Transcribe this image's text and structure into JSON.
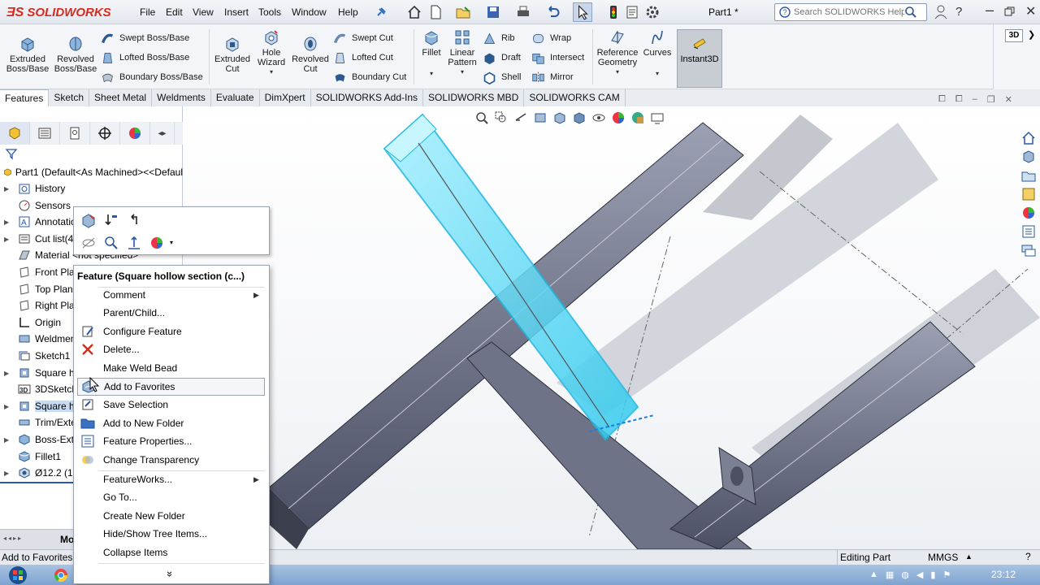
{
  "app": {
    "name": "SOLIDWORKS",
    "doc_title": "Part1 *"
  },
  "menu": [
    "File",
    "Edit",
    "View",
    "Insert",
    "Tools",
    "Window",
    "Help"
  ],
  "search": {
    "placeholder": "Search SOLIDWORKS Help"
  },
  "ribbon": {
    "big": [
      {
        "label1": "Extruded",
        "label2": "Boss/Base"
      },
      {
        "label1": "Revolved",
        "label2": "Boss/Base"
      },
      {
        "label1": "Extruded",
        "label2": "Cut"
      },
      {
        "label1": "Hole",
        "label2": "Wizard"
      },
      {
        "label1": "Revolved",
        "label2": "Cut"
      },
      {
        "label1": "Fillet",
        "label2": ""
      },
      {
        "label1": "Linear",
        "label2": "Pattern"
      },
      {
        "label1": "Reference",
        "label2": "Geometry"
      },
      {
        "label1": "Curves",
        "label2": ""
      }
    ],
    "small": [
      "Swept Boss/Base",
      "Lofted Boss/Base",
      "Boundary Boss/Base",
      "Swept Cut",
      "Lofted Cut",
      "Boundary Cut",
      "Rib",
      "Draft",
      "Shell",
      "Wrap",
      "Intersect",
      "Mirror"
    ],
    "instant3d": "Instant3D",
    "view_label": "3D"
  },
  "tabs": [
    "Features",
    "Sketch",
    "Sheet Metal",
    "Weldments",
    "Evaluate",
    "DimXpert",
    "SOLIDWORKS Add-Ins",
    "SOLIDWORKS MBD",
    "SOLIDWORKS CAM"
  ],
  "tree": {
    "root": "Part1  (Default<As Machined><<Defaul",
    "items": [
      "History",
      "Sensors",
      "Annotatio",
      "Cut list(4",
      "Material <not specified>",
      "Front Pla",
      "Top Plan",
      "Right Pla",
      "Origin",
      "Weldmen",
      "Sketch1",
      "Square ho",
      "3DSketch",
      "Square ho",
      "Trim/Exte",
      "Boss-Extr",
      "Fillet1",
      "Ø12.2 (12"
    ]
  },
  "context_menu": {
    "title": "Feature (Square hollow section (c...)",
    "items": [
      "Comment",
      "Parent/Child...",
      "Configure Feature",
      "Delete...",
      "Make Weld Bead",
      "Add to Favorites",
      "Save Selection",
      "Add to New Folder",
      "Feature Properties...",
      "Change Transparency",
      "FeatureWorks...",
      "Go To...",
      "Create New Folder",
      "Hide/Show Tree Items...",
      "Collapse Items"
    ],
    "more": "»"
  },
  "status": {
    "left": "Add to Favorites",
    "mode": "Editing Part",
    "units": "MMGS",
    "bottom_tab": "Mo"
  },
  "taskbar": {
    "time": "23:12"
  },
  "colors": {
    "brand": "#d52b1e",
    "selection": "#3fd6f5",
    "beam": "#6b7084"
  }
}
